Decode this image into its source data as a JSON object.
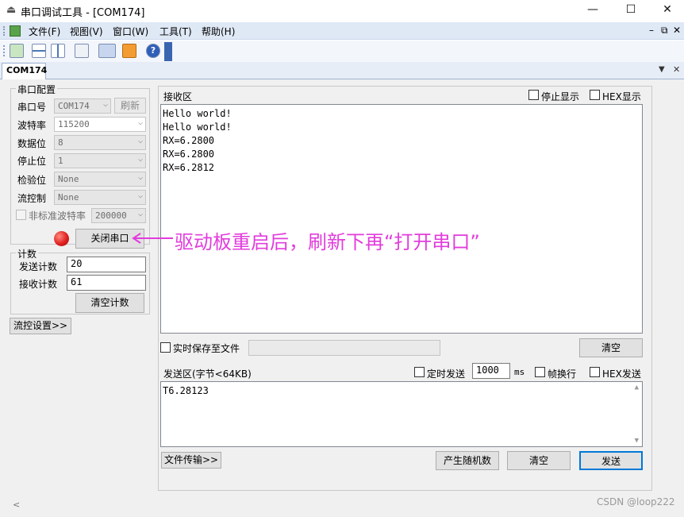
{
  "window": {
    "title": "串口调试工具 - [COM174]",
    "minimize": "—",
    "maximize": "☐",
    "close": "✕"
  },
  "menu": [
    "文件(F)",
    "视图(V)",
    "窗口(W)",
    "工具(T)",
    "帮助(H)"
  ],
  "mdi_controls": [
    "–",
    "⧉",
    "✕"
  ],
  "tab": {
    "label": "COM174"
  },
  "serial_config": {
    "group_title": "串口配置",
    "port_label": "串口号",
    "port_value": "COM174",
    "refresh_label": "刷新",
    "baud_label": "波特率",
    "baud_value": "115200",
    "databits_label": "数据位",
    "databits_value": "8",
    "stopbits_label": "停止位",
    "stopbits_value": "1",
    "parity_label": "检验位",
    "parity_value": "None",
    "flow_label": "流控制",
    "flow_value": "None",
    "nonstd_label": "非标准波特率",
    "nonstd_value": "200000",
    "close_port_label": "关闭串口",
    "status_color": "#e02020"
  },
  "counter": {
    "group_title": "计数",
    "send_label": "发送计数",
    "send_value": "20",
    "recv_label": "接收计数",
    "recv_value": "61",
    "clear_label": "清空计数"
  },
  "flow_settings_label": "流控设置>>",
  "receive": {
    "title": "接收区",
    "stop_display_label": "停止显示",
    "hex_display_label": "HEX显示",
    "lines": [
      "Hello world!",
      "Hello world!",
      "RX=6.2800",
      "RX=6.2800",
      "RX=6.2812"
    ],
    "save_to_file_label": "实时保存至文件",
    "clear_label": "清空"
  },
  "send": {
    "title": "发送区(字节<64KB)",
    "timed_label": "定时发送",
    "interval_value": "1000",
    "interval_unit": "ms",
    "frame_newline_label": "帧换行",
    "hex_send_label": "HEX发送",
    "text": "T6.28123",
    "file_transfer_label": "文件传输>>",
    "random_label": "产生随机数",
    "clear_label": "清空",
    "send_label": "发送"
  },
  "annotation": "驱动板重启后，刷新下再“打开串口”",
  "watermark": "CSDN @loop222",
  "accent_color": "#e23cdc"
}
